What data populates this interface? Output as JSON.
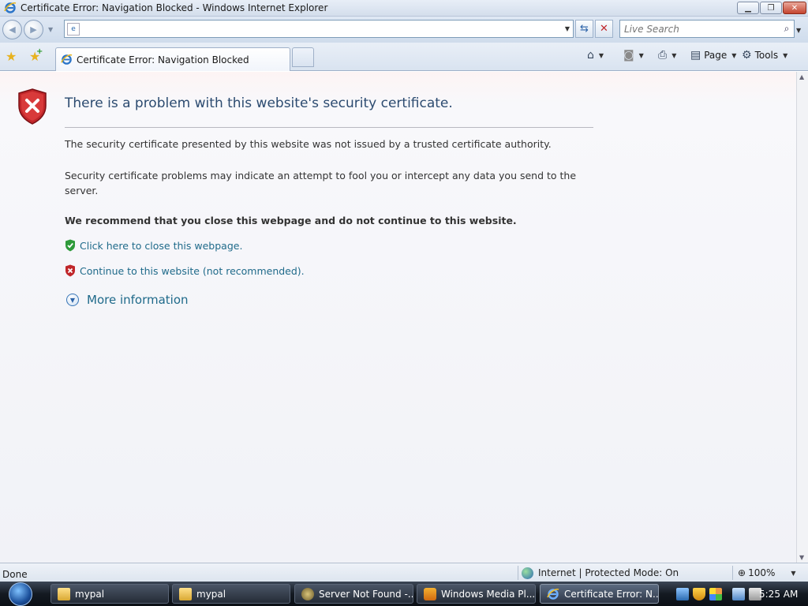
{
  "window": {
    "title": "Certificate Error: Navigation Blocked - Windows Internet Explorer"
  },
  "toolbar": {
    "address_value": "",
    "search_placeholder": "Live Search"
  },
  "tab": {
    "label": "Certificate Error: Navigation Blocked"
  },
  "commands": {
    "page_label": "Page",
    "tools_label": "Tools"
  },
  "page": {
    "heading": "There is a problem with this website's security certificate.",
    "p1": "The security certificate presented by this website was not issued by a trusted certificate authority.",
    "p2": "Security certificate problems may indicate an attempt to fool you or intercept any data you send to the server.",
    "recommend": "We recommend that you close this webpage and do not continue to this website.",
    "close_link": "Click here to close this webpage.",
    "continue_link": "Continue to this website (not recommended).",
    "more_info": "More information"
  },
  "status": {
    "text": "Done",
    "zone": "Internet | Protected Mode: On",
    "zoom": "100%"
  },
  "taskbar": {
    "items": [
      {
        "label": "mypal"
      },
      {
        "label": "mypal"
      },
      {
        "label": "Server Not Found -..."
      },
      {
        "label": "Windows Media Pl..."
      },
      {
        "label": "Certificate Error: N..."
      }
    ],
    "clock": "5:25 AM"
  },
  "colors": {
    "link": "#1f6a8a",
    "heading": "#2c4b70",
    "shield_red": "#c0262a",
    "shield_green": "#2e9a3a"
  }
}
